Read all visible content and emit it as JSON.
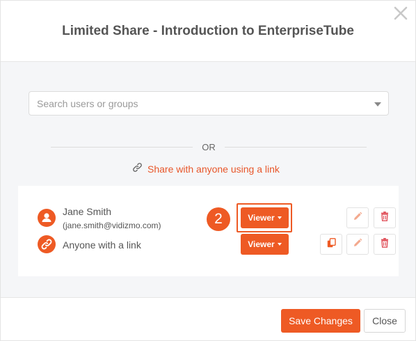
{
  "dialog": {
    "title": "Limited Share - Introduction to EnterpriseTube"
  },
  "search": {
    "placeholder": "Search users or groups"
  },
  "divider": {
    "text": "OR"
  },
  "share_link": {
    "label": "Share with anyone using a link"
  },
  "shares": [
    {
      "name": "Jane Smith",
      "email": "(jane.smith@vidizmo.com)",
      "role": "Viewer",
      "icon": "user-icon"
    },
    {
      "name": "Anyone with a link",
      "role": "Viewer",
      "icon": "link-icon"
    }
  ],
  "callout": {
    "number": "2"
  },
  "footer": {
    "save_label": "Save Changes",
    "close_label": "Close"
  },
  "colors": {
    "accent": "#ee5a24",
    "link_text": "#e8562a",
    "body_bg": "#f5f6f8",
    "delete_icon": "#e0505a"
  }
}
